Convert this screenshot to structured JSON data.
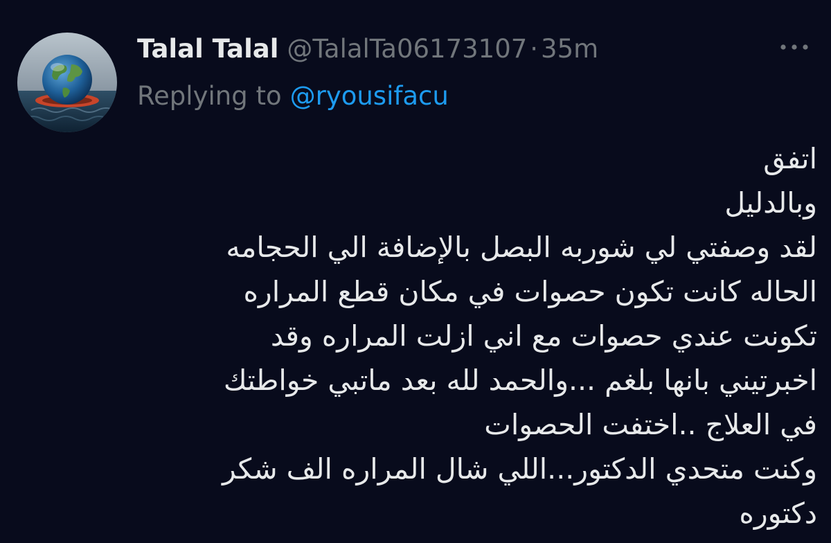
{
  "tweet": {
    "display_name": "Talal Talal",
    "handle": "@TalalTa06173107",
    "separator": "·",
    "time": "35m",
    "replying_prefix": "Replying to",
    "reply_to": "@ryousifacu",
    "more_icon": "more-horizontal-icon",
    "body_lines": [
      "اتفق",
      "وبالدليل",
      "لقد وصفتي لي شوربه البصل بالإضافة الي الحجامه",
      "الحاله كانت تكون حصوات في مكان قطع المراره",
      "تكونت عندي حصوات مع اني ازلت المراره وقد",
      "اخبرتيني بانها بلغم ...والحمد لله بعد ماتبي خواطتك",
      "في العلاج ..اختفت الحصوات",
      "وكنت متحدي الدكتور...اللي شال المراره  الف شكر",
      "دكتوره"
    ]
  },
  "colors": {
    "background": "#080b1c",
    "text_primary": "#e7e9ea",
    "text_secondary": "#71767b",
    "link": "#1d9bf0"
  }
}
